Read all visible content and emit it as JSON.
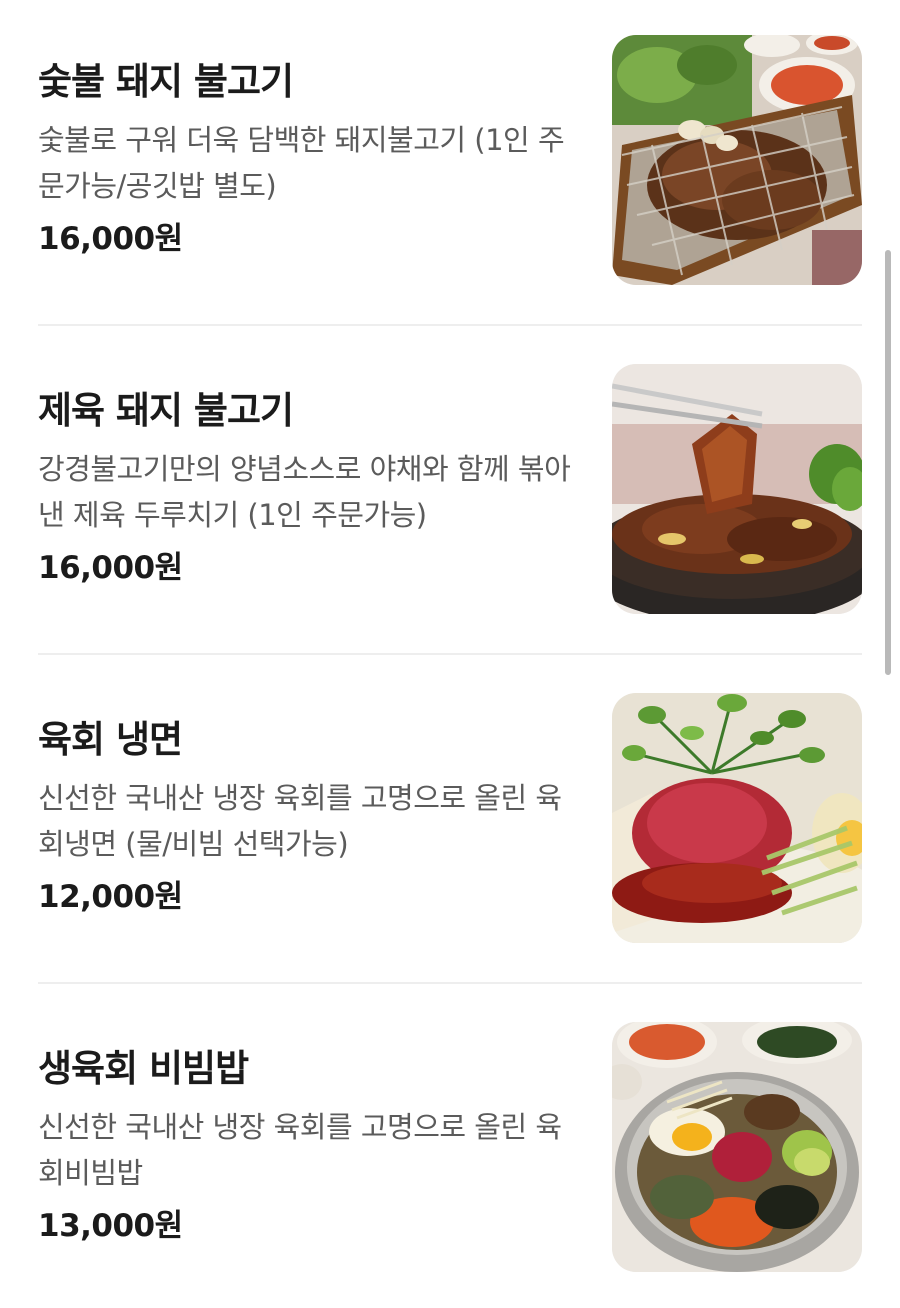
{
  "menu": {
    "items": [
      {
        "name": "숯불 돼지 불고기",
        "description": "숯불로 구워 더욱 담백한 돼지불고기 (1인 주문가능/공깃밥 별도)",
        "price": "16,000원",
        "image_icon": "grilled-pork-bulgogi-photo"
      },
      {
        "name": "제육 돼지 불고기",
        "description": "강경불고기만의 양념소스로 야채와 함께 볶아낸 제육 두루치기 (1인 주문가능)",
        "price": "16,000원",
        "image_icon": "spicy-pork-stirfry-photo"
      },
      {
        "name": "육회 냉면",
        "description": "신선한 국내산 냉장 육회를 고명으로 올린 육회냉면 (물/비빔 선택가능)",
        "price": "12,000원",
        "image_icon": "yukhoe-naengmyeon-photo"
      },
      {
        "name": "생육회 비빔밥",
        "description": "신선한 국내산 냉장 육회를 고명으로 올린 육회비빔밥",
        "price": "13,000원",
        "image_icon": "yukhoe-bibimbap-photo"
      }
    ]
  },
  "colors": {
    "text_primary": "#1b1b1b",
    "text_secondary": "#5b5b5b",
    "divider": "#eeeeee",
    "scrollbar": "#b9b9b9"
  }
}
